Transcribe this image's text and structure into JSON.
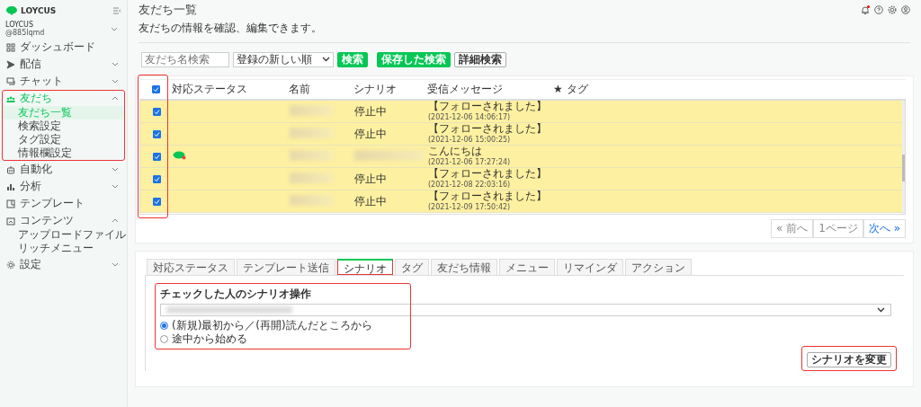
{
  "sidebar": {
    "logo": "LOYCUS",
    "account": {
      "name": "LOYCUS",
      "id": "@885lqmd"
    },
    "items": [
      {
        "label": "ダッシュボード",
        "selected": false,
        "highlighted": false
      },
      {
        "label": "配信",
        "expanded": false,
        "selected": false,
        "highlighted": false
      },
      {
        "label": "チャット",
        "expanded": false,
        "selected": false,
        "highlighted": false
      },
      {
        "label": "友だち",
        "expanded": true,
        "selected": true,
        "highlighted": true,
        "children": [
          {
            "label": "友だち一覧",
            "selected": true
          },
          {
            "label": "検索設定",
            "selected": false
          },
          {
            "label": "タグ設定",
            "selected": false
          },
          {
            "label": "情報欄設定",
            "selected": false
          }
        ]
      },
      {
        "label": "自動化",
        "expanded": false,
        "selected": false,
        "highlighted": false
      },
      {
        "label": "分析",
        "expanded": false,
        "selected": false,
        "highlighted": false
      },
      {
        "label": "テンプレート",
        "selected": false,
        "highlighted": false
      },
      {
        "label": "コンテンツ",
        "expanded": true,
        "selected": false,
        "highlighted": false,
        "children": [
          {
            "label": "アップロードファイル",
            "selected": false
          },
          {
            "label": "リッチメニュー",
            "selected": false
          }
        ]
      },
      {
        "label": "設定",
        "expanded": false,
        "selected": false,
        "highlighted": false
      }
    ]
  },
  "page": {
    "title": "友だち一覧",
    "subtitle": "友だちの情報を確認、編集できます。"
  },
  "search": {
    "placeholder": "友だち名検索",
    "sort": "登録の新しい順",
    "search_button": "検索",
    "saved_button": "保存した検索",
    "advanced_button": "詳細検索"
  },
  "table": {
    "header_checked": true,
    "checkbox_column_highlighted": true,
    "columns": [
      "対応ステータス",
      "名前",
      "シナリオ",
      "受信メッセージ",
      "★ タグ"
    ],
    "rows": [
      {
        "checked": true,
        "status_icon": false,
        "scenario": "停止中",
        "message": "【フォローされました】",
        "time": "(2021-12-06 14:06:17)"
      },
      {
        "checked": true,
        "status_icon": false,
        "scenario": "停止中",
        "message": "【フォローされました】",
        "time": "(2021-12-06 15:00:25)"
      },
      {
        "checked": true,
        "status_icon": true,
        "message": "こんにちは",
        "time": "(2021-12-06 17:27:24)"
      },
      {
        "checked": true,
        "status_icon": false,
        "scenario": "停止中",
        "message": "【フォローされました】",
        "time": "(2021-12-08 22:03:16)"
      },
      {
        "checked": true,
        "status_icon": false,
        "scenario": "停止中",
        "message": "【フォローされました】",
        "time": "(2021-12-09 17:50:42)"
      }
    ]
  },
  "pagination": {
    "prev": "« 前へ",
    "page": "1ページ",
    "next": "次へ »"
  },
  "action_tabs": [
    {
      "label": "対応ステータス",
      "selected": false,
      "highlighted": false
    },
    {
      "label": "テンプレート送信",
      "selected": false,
      "highlighted": false
    },
    {
      "label": "シナリオ",
      "selected": true,
      "highlighted": true
    },
    {
      "label": "タグ",
      "selected": false,
      "highlighted": false
    },
    {
      "label": "友だち情報",
      "selected": false,
      "highlighted": false
    },
    {
      "label": "メニュー",
      "selected": false,
      "highlighted": false
    },
    {
      "label": "リマインダ",
      "selected": false,
      "highlighted": false
    },
    {
      "label": "アクション",
      "selected": false,
      "highlighted": false
    }
  ],
  "scenario_panel": {
    "highlighted": true,
    "label": "チェックした人のシナリオ操作",
    "options": [
      {
        "label": "(新規)最初から／(再開)読んだところから",
        "selected": true
      },
      {
        "label": "途中から始める",
        "selected": false
      }
    ],
    "button": {
      "label": "シナリオを変更",
      "highlighted": true
    }
  }
}
